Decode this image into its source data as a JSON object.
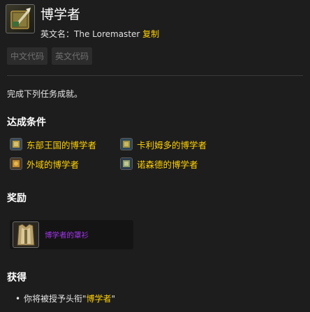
{
  "achievement": {
    "title": "博学者",
    "english_prefix": "英文名：",
    "english_name": "The Loremaster",
    "copy_label": "复制",
    "icon": "book-quill-icon"
  },
  "lang_tabs": [
    "中文代码",
    "英文代码"
  ],
  "description": "完成下列任务成就。",
  "criteria": {
    "heading": "达成条件",
    "items": [
      {
        "label": "东部王国的博学者",
        "icon": "eastern-kingdoms-icon"
      },
      {
        "label": "卡利姆多的博学者",
        "icon": "kalimdor-icon"
      },
      {
        "label": "外域的博学者",
        "icon": "outland-icon"
      },
      {
        "label": "诺森德的博学者",
        "icon": "northrend-icon"
      }
    ]
  },
  "reward": {
    "heading": "奖励",
    "item_label": "博学者的罩衫",
    "icon": "tabard-icon",
    "quality_color": "#a335ee"
  },
  "gain": {
    "heading": "获得",
    "bullet": "•",
    "prefix": "你将被授予头衔\"",
    "title_name": "博学者",
    "suffix": "\""
  },
  "colors": {
    "background": "#1d1d1d",
    "accent": "#ffd100",
    "epic": "#a335ee"
  }
}
